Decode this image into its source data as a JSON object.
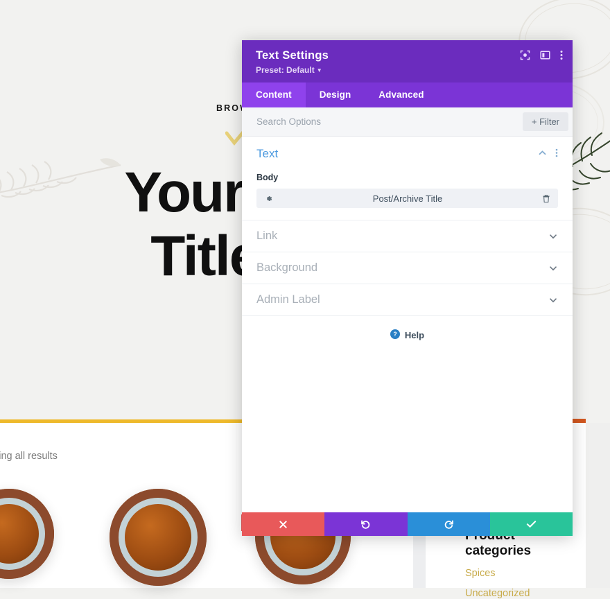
{
  "page": {
    "eyebrow": "BROWSE THROUGH OUR SPICES",
    "hero_title": "Your Dynamic\nTitle Will Go\nHere",
    "result_count": "Showing all results",
    "widget": {
      "title": "Product\ncategories",
      "links": [
        "Spices",
        "Uncategorized"
      ]
    },
    "colors": {
      "background": "#f2f2f0",
      "gold_rule": "#eeb92b",
      "link": "#c8ab4a",
      "orange_tab": "#d2571f"
    }
  },
  "panel": {
    "title": "Text Settings",
    "preset": "Preset: Default",
    "header_icons": [
      {
        "name": "focus-icon"
      },
      {
        "name": "layout-panel-icon"
      },
      {
        "name": "more-vertical-icon"
      }
    ],
    "tabs": [
      {
        "label": "Content",
        "active": true
      },
      {
        "label": "Design",
        "active": false
      },
      {
        "label": "Advanced",
        "active": false
      }
    ],
    "search": {
      "placeholder": "Search Options",
      "value": ""
    },
    "filter_button": "+ Filter",
    "sections": [
      {
        "title": "Text",
        "expanded": true,
        "field_label": "Body",
        "field_value": "Post/Archive Title"
      },
      {
        "title": "Link",
        "expanded": false
      },
      {
        "title": "Background",
        "expanded": false
      },
      {
        "title": "Admin Label",
        "expanded": false
      }
    ],
    "help_label": "Help",
    "actions": [
      {
        "name": "cancel-button",
        "glyph": "✖",
        "color": "#e8595a"
      },
      {
        "name": "undo-button",
        "glyph": "↺",
        "color": "#7b34d6"
      },
      {
        "name": "redo-button",
        "glyph": "↻",
        "color": "#2a8fd8"
      },
      {
        "name": "save-button",
        "glyph": "✔",
        "color": "#29c49a"
      }
    ],
    "colors": {
      "header": "#6b2cbe",
      "tabbar": "#7b34d6",
      "tab_active": "#8f42ec",
      "section_title": "#4d9adf"
    }
  }
}
